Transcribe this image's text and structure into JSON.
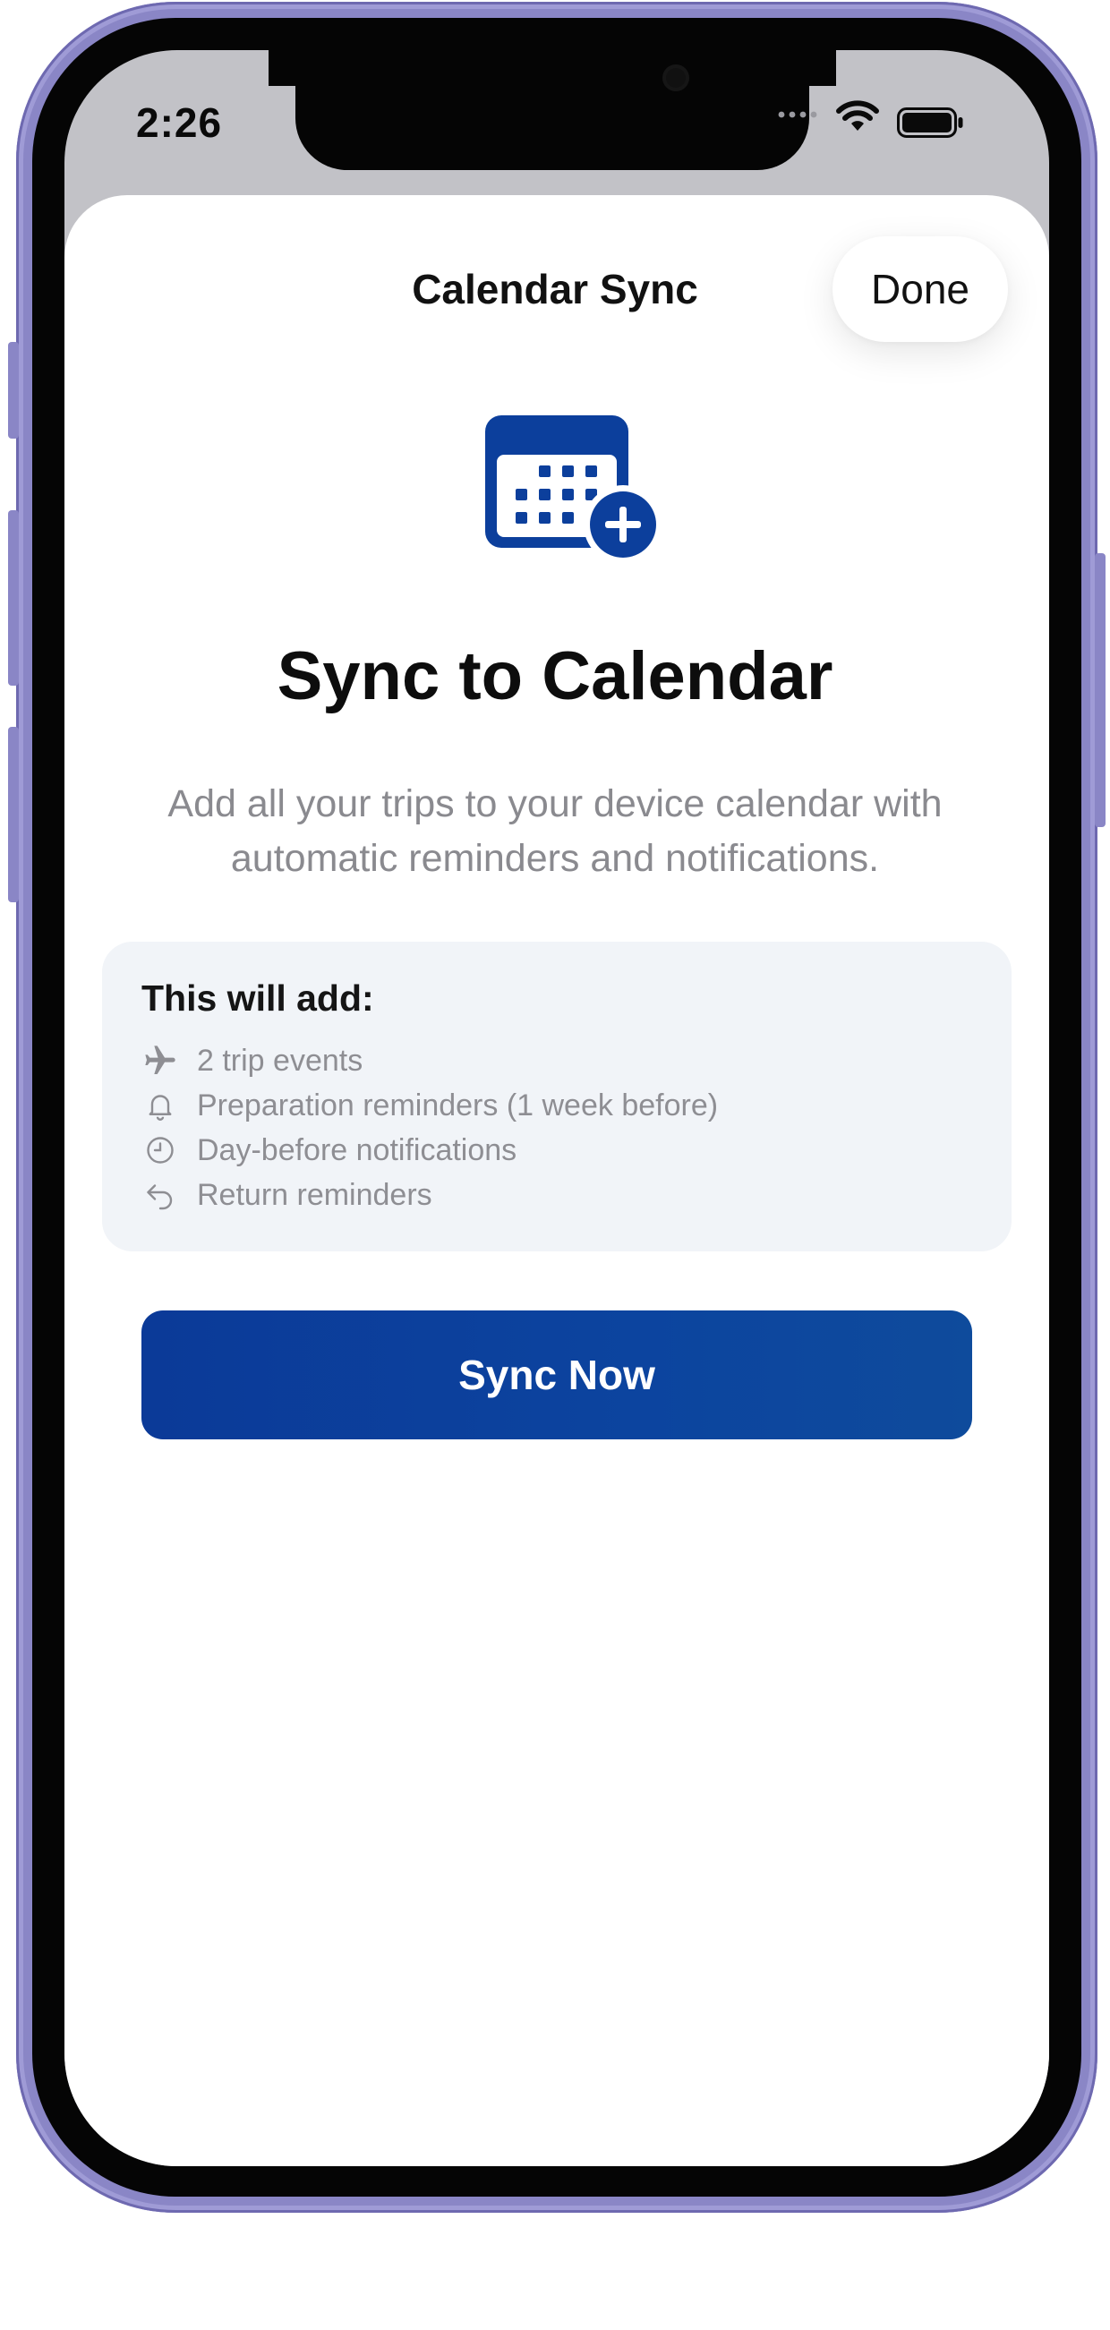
{
  "status_bar": {
    "time": "2:26"
  },
  "nav": {
    "title": "Calendar Sync",
    "done_label": "Done"
  },
  "hero": {
    "icon": "calendar-add-icon",
    "headline": "Sync to Calendar",
    "description": "Add all your trips to your device calendar with automatic reminders and notifications."
  },
  "info": {
    "title": "This will add:",
    "items": [
      {
        "icon": "airplane-icon",
        "label": "2 trip events"
      },
      {
        "icon": "bell-icon",
        "label": "Preparation reminders (1 week before)"
      },
      {
        "icon": "clock-icon",
        "label": "Day-before notifications"
      },
      {
        "icon": "return-arrow-icon",
        "label": "Return reminders"
      }
    ]
  },
  "actions": {
    "sync_label": "Sync Now"
  },
  "colors": {
    "accent": "#0C449F",
    "sheet_background": "#FFFFFF",
    "info_background": "#F1F4F8",
    "device_frame": "#8A86C6"
  }
}
